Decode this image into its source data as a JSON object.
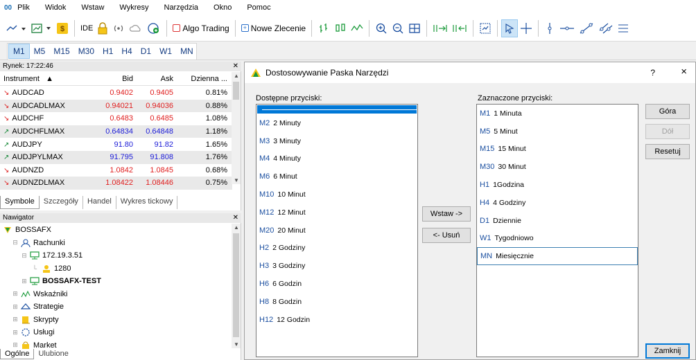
{
  "menu": {
    "logo": "00",
    "items": [
      "Plik",
      "Widok",
      "Wstaw",
      "Wykresy",
      "Narzędzia",
      "Okno",
      "Pomoc"
    ]
  },
  "toolbar": {
    "ide_label": "IDE",
    "algo_label": "Algo Trading",
    "new_order_label": "Nowe Zlecenie"
  },
  "timeframes": [
    "M1",
    "M5",
    "M15",
    "M30",
    "H1",
    "H4",
    "D1",
    "W1",
    "MN"
  ],
  "market": {
    "title": "Rynek: 17:22:46",
    "columns": [
      "Instrument",
      "Bid",
      "Ask",
      "Dzienna ..."
    ],
    "rows": [
      {
        "instrument": "AUDCAD",
        "dir": "down",
        "bid": "0.9402",
        "ask": "0.9405",
        "change": "0.81%",
        "color": "red"
      },
      {
        "instrument": "AUDCADLMAX",
        "dir": "down",
        "bid": "0.94021",
        "ask": "0.94036",
        "change": "0.88%",
        "color": "red"
      },
      {
        "instrument": "AUDCHF",
        "dir": "down",
        "bid": "0.6483",
        "ask": "0.6485",
        "change": "1.08%",
        "color": "red"
      },
      {
        "instrument": "AUDCHFLMAX",
        "dir": "up",
        "bid": "0.64834",
        "ask": "0.64848",
        "change": "1.18%",
        "color": "blue"
      },
      {
        "instrument": "AUDJPY",
        "dir": "up",
        "bid": "91.80",
        "ask": "91.82",
        "change": "1.65%",
        "color": "blue"
      },
      {
        "instrument": "AUDJPYLMAX",
        "dir": "up",
        "bid": "91.795",
        "ask": "91.808",
        "change": "1.76%",
        "color": "blue"
      },
      {
        "instrument": "AUDNZD",
        "dir": "down",
        "bid": "1.0842",
        "ask": "1.0845",
        "change": "0.68%",
        "color": "red"
      },
      {
        "instrument": "AUDNZDLMAX",
        "dir": "down",
        "bid": "1.08422",
        "ask": "1.08446",
        "change": "0.75%",
        "color": "red"
      }
    ],
    "tabs": [
      "Symbole",
      "Szczegóły",
      "Handel",
      "Wykres tickowy"
    ]
  },
  "navigator": {
    "title": "Nawigator",
    "items": [
      {
        "label": "BOSSAFX",
        "level": 0,
        "icon": "broker-icon",
        "bold": false
      },
      {
        "label": "Rachunki",
        "level": 1,
        "icon": "accounts-icon",
        "bold": false
      },
      {
        "label": "172.19.3.51",
        "level": 2,
        "icon": "server-icon",
        "bold": false
      },
      {
        "label": "1280",
        "level": 3,
        "icon": "user-icon",
        "bold": false
      },
      {
        "label": "BOSSAFX-TEST",
        "level": 2,
        "icon": "server-icon",
        "bold": true
      },
      {
        "label": "Wskaźniki",
        "level": 1,
        "icon": "indicators-icon",
        "bold": false
      },
      {
        "label": "Strategie",
        "level": 1,
        "icon": "strategies-icon",
        "bold": false
      },
      {
        "label": "Skrypty",
        "level": 1,
        "icon": "scripts-icon",
        "bold": false
      },
      {
        "label": "Usługi",
        "level": 1,
        "icon": "services-icon",
        "bold": false
      },
      {
        "label": "Market",
        "level": 1,
        "icon": "market-icon",
        "bold": false
      }
    ],
    "tabs": [
      "Ogólne",
      "Ulubione"
    ]
  },
  "dialog": {
    "title": "Dostosowywanie Paska Narzędzi",
    "help": "?",
    "close": "×",
    "available_label": "Dostępne przyciski:",
    "selected_label": "Zaznaczone przyciski:",
    "available": [
      {
        "code": "M2",
        "label": "2 Minuty"
      },
      {
        "code": "M3",
        "label": "3 Minuty"
      },
      {
        "code": "M4",
        "label": "4 Minuty"
      },
      {
        "code": "M6",
        "label": "6 Minut"
      },
      {
        "code": "M10",
        "label": "10 Minut"
      },
      {
        "code": "M12",
        "label": "12 Minut"
      },
      {
        "code": "M20",
        "label": "20 Minut"
      },
      {
        "code": "H2",
        "label": "2 Godziny"
      },
      {
        "code": "H3",
        "label": "3 Godziny"
      },
      {
        "code": "H6",
        "label": "6 Godzin"
      },
      {
        "code": "H8",
        "label": "8 Godzin"
      },
      {
        "code": "H12",
        "label": "12 Godzin"
      }
    ],
    "selected": [
      {
        "code": "M1",
        "label": "1 Minuta"
      },
      {
        "code": "M5",
        "label": "5 Minut"
      },
      {
        "code": "M15",
        "label": "15 Minut"
      },
      {
        "code": "M30",
        "label": "30 Minut"
      },
      {
        "code": "H1",
        "label": "1Godzina"
      },
      {
        "code": "H4",
        "label": "4 Godziny"
      },
      {
        "code": "D1",
        "label": "Dziennie"
      },
      {
        "code": "W1",
        "label": "Tygodniowo"
      },
      {
        "code": "MN",
        "label": "Miesięcznie"
      }
    ],
    "buttons": {
      "insert": "Wstaw ->",
      "remove": "<- Usuń",
      "up": "Góra",
      "down": "Dół",
      "reset": "Resetuj",
      "close": "Zamknij"
    }
  }
}
